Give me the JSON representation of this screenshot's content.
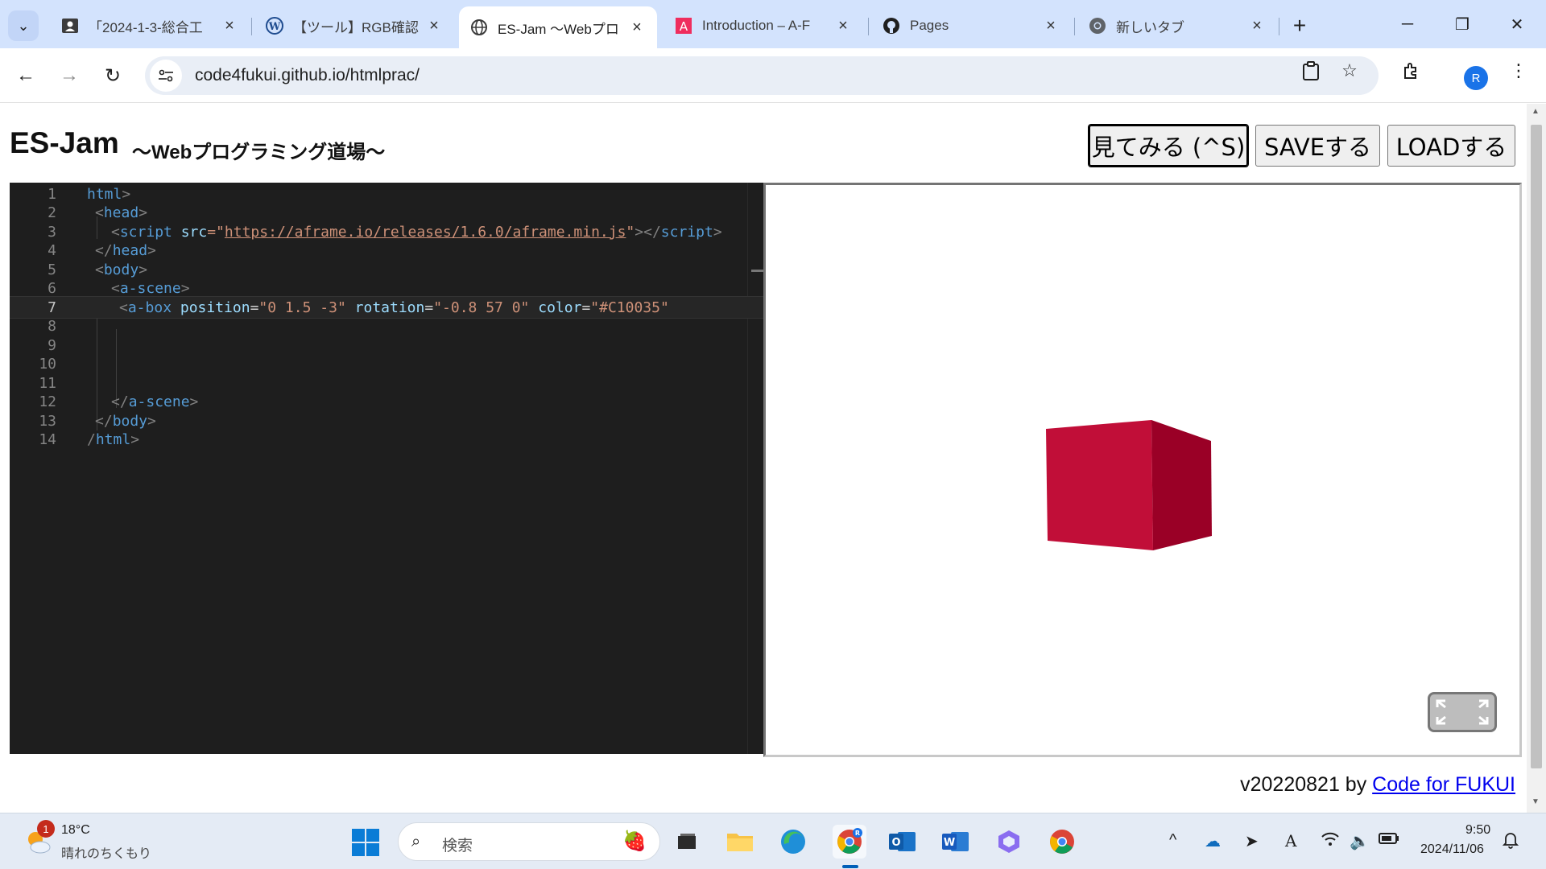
{
  "browser": {
    "tabs": [
      {
        "title": "「2024-1-3-総合工",
        "icon": "person-card-icon"
      },
      {
        "title": "【ツール】RGB確認ツ",
        "icon": "wordpress-icon"
      },
      {
        "title": "ES-Jam 〜Webプロ",
        "icon": "globe-icon",
        "active": true
      },
      {
        "title": "Introduction – A-F",
        "icon": "aframe-icon"
      },
      {
        "title": "Pages",
        "icon": "github-icon"
      },
      {
        "title": "新しいタブ",
        "icon": "chrome-icon"
      }
    ],
    "new_tab_label": "+",
    "url": "code4fukui.github.io/htmlprac/",
    "profile_initial": "R"
  },
  "page": {
    "title": "ES-Jam",
    "subtitle": "〜Webプログラミング道場〜",
    "buttons": {
      "view": "見てみる (^S)",
      "save": "SAVEする",
      "load": "LOADする"
    },
    "footer": {
      "version": "v20220821 by ",
      "link": "Code for FUKUI"
    }
  },
  "editor": {
    "line_numbers": [
      "1",
      "2",
      "3",
      "4",
      "5",
      "6",
      "7",
      "8",
      "9",
      "10",
      "11",
      "12",
      "13",
      "14"
    ],
    "current_line": 7,
    "lines": [
      [
        {
          "t": "html",
          "c": "tag"
        },
        {
          "t": ">",
          "c": "br"
        }
      ],
      [
        {
          "t": "<",
          "c": "br"
        },
        {
          "t": "head",
          "c": "tag"
        },
        {
          "t": ">",
          "c": "br"
        }
      ],
      [
        {
          "t": "<",
          "c": "br"
        },
        {
          "t": "script",
          "c": "tag"
        },
        {
          "t": " ",
          "c": "plain"
        },
        {
          "t": "src",
          "c": "attr"
        },
        {
          "t": "=\"",
          "c": "str"
        },
        {
          "t": "https://aframe.io/releases/1.6.0/aframe.min.js",
          "c": "url"
        },
        {
          "t": "\"",
          "c": "str"
        },
        {
          "t": "></",
          "c": "br"
        },
        {
          "t": "script",
          "c": "tag"
        },
        {
          "t": ">",
          "c": "br"
        }
      ],
      [
        {
          "t": "</",
          "c": "br"
        },
        {
          "t": "head",
          "c": "tag"
        },
        {
          "t": ">",
          "c": "br"
        }
      ],
      [
        {
          "t": "<",
          "c": "br"
        },
        {
          "t": "body",
          "c": "tag"
        },
        {
          "t": ">",
          "c": "br"
        }
      ],
      [
        {
          "t": "<",
          "c": "br"
        },
        {
          "t": "a-scene",
          "c": "tag"
        },
        {
          "t": ">",
          "c": "br"
        }
      ],
      [
        {
          "t": "<",
          "c": "br"
        },
        {
          "t": "a-box",
          "c": "tag"
        },
        {
          "t": " ",
          "c": "plain"
        },
        {
          "t": "position",
          "c": "attr"
        },
        {
          "t": "=",
          "c": "plain"
        },
        {
          "t": "\"0 1.5 -3\"",
          "c": "str"
        },
        {
          "t": " ",
          "c": "plain"
        },
        {
          "t": "rotation",
          "c": "attr"
        },
        {
          "t": "=",
          "c": "plain"
        },
        {
          "t": "\"-0.8 57 0\"",
          "c": "str"
        },
        {
          "t": " ",
          "c": "plain"
        },
        {
          "t": "color",
          "c": "attr"
        },
        {
          "t": "=",
          "c": "plain"
        },
        {
          "t": "\"#C10035\"",
          "c": "str"
        }
      ],
      [],
      [],
      [],
      [],
      [
        {
          "t": "</",
          "c": "br"
        },
        {
          "t": "a-scene",
          "c": "tag"
        },
        {
          "t": ">",
          "c": "br"
        }
      ],
      [
        {
          "t": "</",
          "c": "br"
        },
        {
          "t": "body",
          "c": "tag"
        },
        {
          "t": ">",
          "c": "br"
        }
      ],
      [
        {
          "t": "/",
          "c": "br"
        },
        {
          "t": "html",
          "c": "tag"
        },
        {
          "t": ">",
          "c": "br"
        }
      ]
    ]
  },
  "preview": {
    "box_color": "#C10035",
    "fullscreen_icon": "fullscreen-icon"
  },
  "taskbar": {
    "weather_badge": "1",
    "temperature": "18°C",
    "weather_desc": "晴れのちくもり",
    "search_placeholder": "検索",
    "time": "9:50",
    "date": "2024/11/06",
    "apps": [
      "task-view-icon",
      "file-explorer-icon",
      "edge-icon",
      "chrome-icon",
      "outlook-icon",
      "word-icon",
      "copilot-icon",
      "chrome-canary-icon"
    ],
    "tray": [
      "chevron-up-icon",
      "onedrive-icon",
      "location-icon",
      "ime-icon",
      "wifi-icon",
      "volume-icon",
      "battery-icon",
      "bell-icon"
    ],
    "ime_label": "A"
  },
  "colors": {
    "tabstrip": "#d3e3fd",
    "editor_bg": "#1e1e1e",
    "accent": "#1a73e8"
  }
}
